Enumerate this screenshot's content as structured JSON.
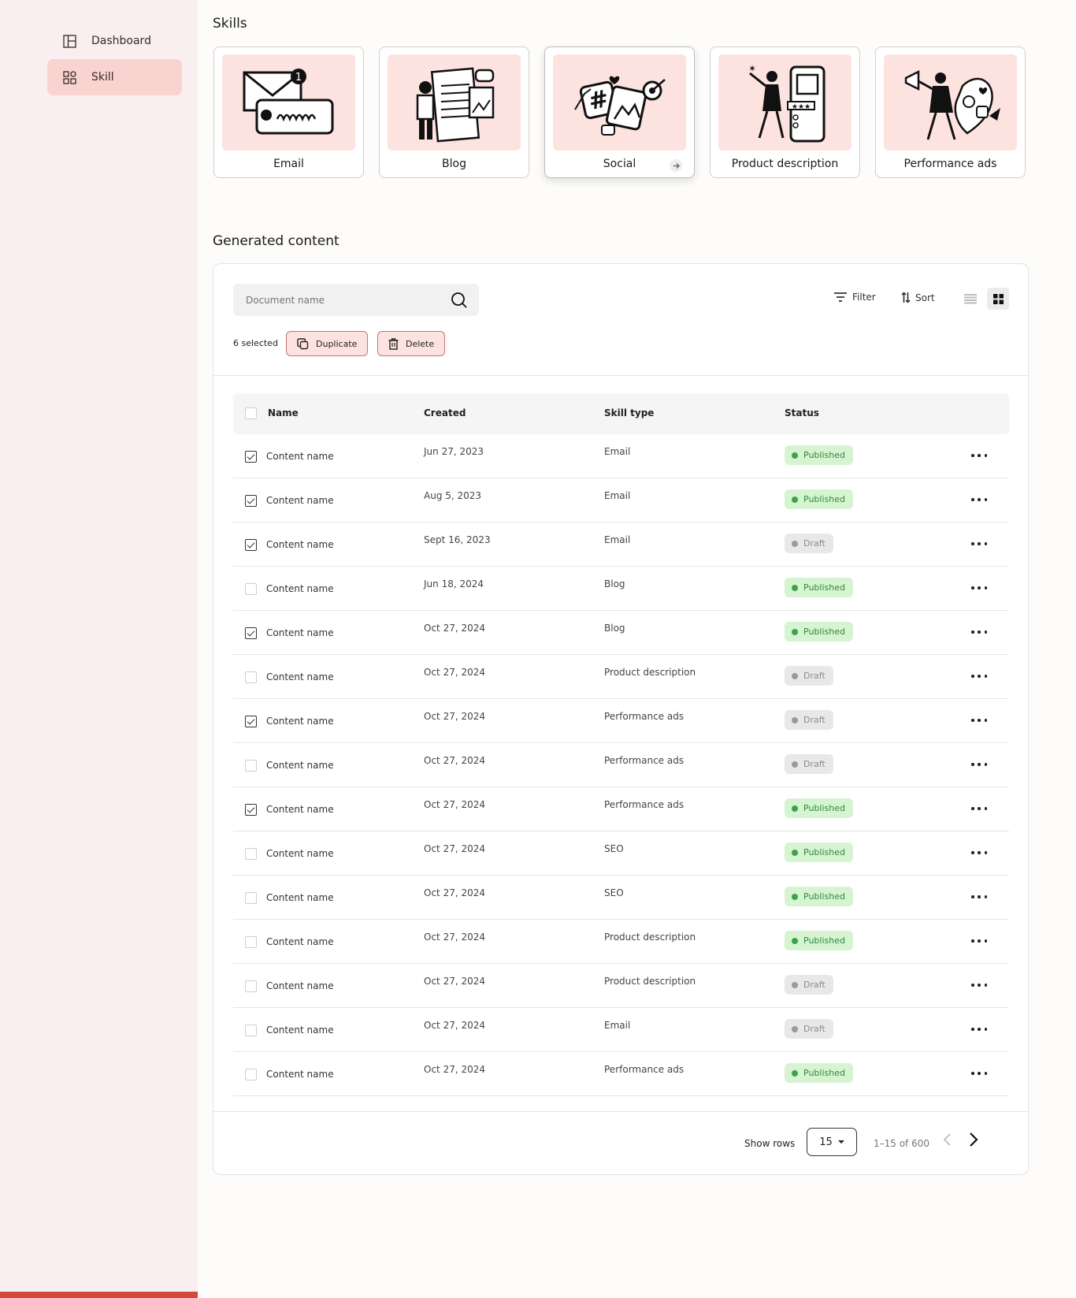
{
  "sidebar": {
    "items": [
      {
        "label": "Dashboard",
        "icon": "layout-icon",
        "active": false
      },
      {
        "label": "Skill",
        "icon": "grid-shapes-icon",
        "active": true
      }
    ]
  },
  "skills": {
    "title": "Skills",
    "cards": [
      {
        "label": "Email",
        "art": "email-illustration"
      },
      {
        "label": "Blog",
        "art": "blog-illustration"
      },
      {
        "label": "Social",
        "art": "social-illustration",
        "active": true
      },
      {
        "label": "Product description",
        "art": "product-illustration"
      },
      {
        "label": "Performance ads",
        "art": "ads-illustration"
      }
    ]
  },
  "content": {
    "title": "Generated content",
    "search_placeholder": "Document name",
    "filter_label": "Filter",
    "sort_label": "Sort",
    "selected_text": "6 selected",
    "duplicate_label": "Duplicate",
    "delete_label": "Delete",
    "columns": {
      "name": "Name",
      "created": "Created",
      "skill_type": "Skill type",
      "status": "Status"
    },
    "rows": [
      {
        "name": "Content name",
        "created": "Jun 27, 2023",
        "type": "Email",
        "status": "Published",
        "checked": true
      },
      {
        "name": "Content name",
        "created": "Aug 5, 2023",
        "type": "Email",
        "status": "Published",
        "checked": true
      },
      {
        "name": "Content name",
        "created": "Sept 16, 2023",
        "type": "Email",
        "status": "Draft",
        "checked": true
      },
      {
        "name": "Content name",
        "created": "Jun 18, 2024",
        "type": "Blog",
        "status": "Published",
        "checked": false
      },
      {
        "name": "Content name",
        "created": "Oct 27, 2024",
        "type": "Blog",
        "status": "Published",
        "checked": true
      },
      {
        "name": "Content name",
        "created": "Oct 27, 2024",
        "type": "Product description",
        "status": "Draft",
        "checked": false
      },
      {
        "name": "Content name",
        "created": "Oct 27, 2024",
        "type": "Performance ads",
        "status": "Draft",
        "checked": true
      },
      {
        "name": "Content name",
        "created": "Oct 27, 2024",
        "type": "Performance ads",
        "status": "Draft",
        "checked": false
      },
      {
        "name": "Content name",
        "created": "Oct 27, 2024",
        "type": "Performance ads",
        "status": "Published",
        "checked": true
      },
      {
        "name": "Content name",
        "created": "Oct 27, 2024",
        "type": "SEO",
        "status": "Published",
        "checked": false
      },
      {
        "name": "Content name",
        "created": "Oct 27, 2024",
        "type": "SEO",
        "status": "Published",
        "checked": false
      },
      {
        "name": "Content name",
        "created": "Oct 27, 2024",
        "type": "Product description",
        "status": "Published",
        "checked": false
      },
      {
        "name": "Content name",
        "created": "Oct 27, 2024",
        "type": "Product description",
        "status": "Draft",
        "checked": false
      },
      {
        "name": "Content name",
        "created": "Oct 27, 2024",
        "type": "Email",
        "status": "Draft",
        "checked": false
      },
      {
        "name": "Content name",
        "created": "Oct 27, 2024",
        "type": "Performance ads",
        "status": "Published",
        "checked": false
      }
    ],
    "footer": {
      "show_rows_label": "Show rows",
      "rows_value": "15",
      "page_count": "1–15 of 600"
    }
  },
  "colors": {
    "accent": "#d6473d",
    "sidebar_bg": "#f9eef0",
    "active_nav": "#f8d3cf",
    "published": "#3ca34a",
    "draft": "#9a9a9a"
  }
}
